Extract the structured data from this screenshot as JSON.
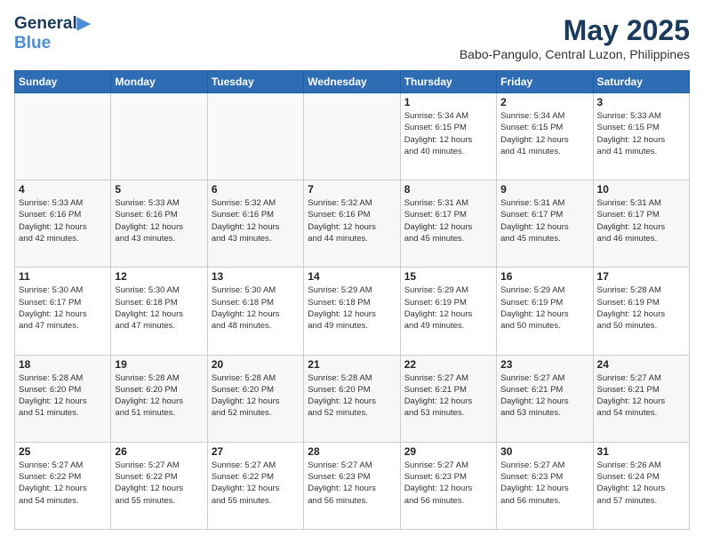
{
  "header": {
    "logo_line1": "General",
    "logo_line2": "Blue",
    "month_year": "May 2025",
    "location": "Babo-Pangulo, Central Luzon, Philippines"
  },
  "weekdays": [
    "Sunday",
    "Monday",
    "Tuesday",
    "Wednesday",
    "Thursday",
    "Friday",
    "Saturday"
  ],
  "weeks": [
    [
      {
        "day": "",
        "info": ""
      },
      {
        "day": "",
        "info": ""
      },
      {
        "day": "",
        "info": ""
      },
      {
        "day": "",
        "info": ""
      },
      {
        "day": "1",
        "info": "Sunrise: 5:34 AM\nSunset: 6:15 PM\nDaylight: 12 hours\nand 40 minutes."
      },
      {
        "day": "2",
        "info": "Sunrise: 5:34 AM\nSunset: 6:15 PM\nDaylight: 12 hours\nand 41 minutes."
      },
      {
        "day": "3",
        "info": "Sunrise: 5:33 AM\nSunset: 6:15 PM\nDaylight: 12 hours\nand 41 minutes."
      }
    ],
    [
      {
        "day": "4",
        "info": "Sunrise: 5:33 AM\nSunset: 6:16 PM\nDaylight: 12 hours\nand 42 minutes."
      },
      {
        "day": "5",
        "info": "Sunrise: 5:33 AM\nSunset: 6:16 PM\nDaylight: 12 hours\nand 43 minutes."
      },
      {
        "day": "6",
        "info": "Sunrise: 5:32 AM\nSunset: 6:16 PM\nDaylight: 12 hours\nand 43 minutes."
      },
      {
        "day": "7",
        "info": "Sunrise: 5:32 AM\nSunset: 6:16 PM\nDaylight: 12 hours\nand 44 minutes."
      },
      {
        "day": "8",
        "info": "Sunrise: 5:31 AM\nSunset: 6:17 PM\nDaylight: 12 hours\nand 45 minutes."
      },
      {
        "day": "9",
        "info": "Sunrise: 5:31 AM\nSunset: 6:17 PM\nDaylight: 12 hours\nand 45 minutes."
      },
      {
        "day": "10",
        "info": "Sunrise: 5:31 AM\nSunset: 6:17 PM\nDaylight: 12 hours\nand 46 minutes."
      }
    ],
    [
      {
        "day": "11",
        "info": "Sunrise: 5:30 AM\nSunset: 6:17 PM\nDaylight: 12 hours\nand 47 minutes."
      },
      {
        "day": "12",
        "info": "Sunrise: 5:30 AM\nSunset: 6:18 PM\nDaylight: 12 hours\nand 47 minutes."
      },
      {
        "day": "13",
        "info": "Sunrise: 5:30 AM\nSunset: 6:18 PM\nDaylight: 12 hours\nand 48 minutes."
      },
      {
        "day": "14",
        "info": "Sunrise: 5:29 AM\nSunset: 6:18 PM\nDaylight: 12 hours\nand 49 minutes."
      },
      {
        "day": "15",
        "info": "Sunrise: 5:29 AM\nSunset: 6:19 PM\nDaylight: 12 hours\nand 49 minutes."
      },
      {
        "day": "16",
        "info": "Sunrise: 5:29 AM\nSunset: 6:19 PM\nDaylight: 12 hours\nand 50 minutes."
      },
      {
        "day": "17",
        "info": "Sunrise: 5:28 AM\nSunset: 6:19 PM\nDaylight: 12 hours\nand 50 minutes."
      }
    ],
    [
      {
        "day": "18",
        "info": "Sunrise: 5:28 AM\nSunset: 6:20 PM\nDaylight: 12 hours\nand 51 minutes."
      },
      {
        "day": "19",
        "info": "Sunrise: 5:28 AM\nSunset: 6:20 PM\nDaylight: 12 hours\nand 51 minutes."
      },
      {
        "day": "20",
        "info": "Sunrise: 5:28 AM\nSunset: 6:20 PM\nDaylight: 12 hours\nand 52 minutes."
      },
      {
        "day": "21",
        "info": "Sunrise: 5:28 AM\nSunset: 6:20 PM\nDaylight: 12 hours\nand 52 minutes."
      },
      {
        "day": "22",
        "info": "Sunrise: 5:27 AM\nSunset: 6:21 PM\nDaylight: 12 hours\nand 53 minutes."
      },
      {
        "day": "23",
        "info": "Sunrise: 5:27 AM\nSunset: 6:21 PM\nDaylight: 12 hours\nand 53 minutes."
      },
      {
        "day": "24",
        "info": "Sunrise: 5:27 AM\nSunset: 6:21 PM\nDaylight: 12 hours\nand 54 minutes."
      }
    ],
    [
      {
        "day": "25",
        "info": "Sunrise: 5:27 AM\nSunset: 6:22 PM\nDaylight: 12 hours\nand 54 minutes."
      },
      {
        "day": "26",
        "info": "Sunrise: 5:27 AM\nSunset: 6:22 PM\nDaylight: 12 hours\nand 55 minutes."
      },
      {
        "day": "27",
        "info": "Sunrise: 5:27 AM\nSunset: 6:22 PM\nDaylight: 12 hours\nand 55 minutes."
      },
      {
        "day": "28",
        "info": "Sunrise: 5:27 AM\nSunset: 6:23 PM\nDaylight: 12 hours\nand 56 minutes."
      },
      {
        "day": "29",
        "info": "Sunrise: 5:27 AM\nSunset: 6:23 PM\nDaylight: 12 hours\nand 56 minutes."
      },
      {
        "day": "30",
        "info": "Sunrise: 5:27 AM\nSunset: 6:23 PM\nDaylight: 12 hours\nand 56 minutes."
      },
      {
        "day": "31",
        "info": "Sunrise: 5:26 AM\nSunset: 6:24 PM\nDaylight: 12 hours\nand 57 minutes."
      }
    ]
  ]
}
